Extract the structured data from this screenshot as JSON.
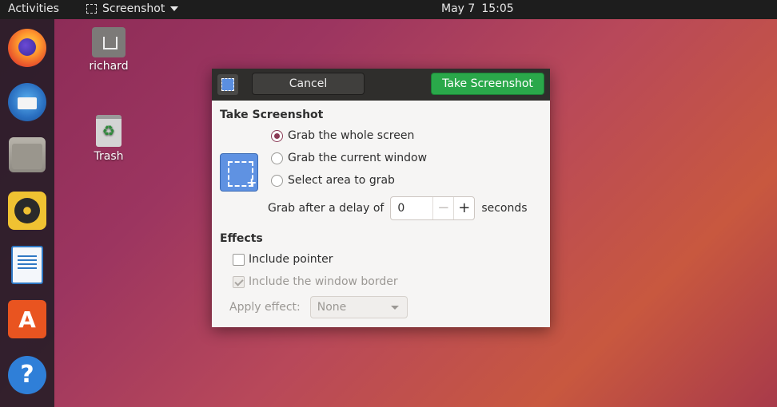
{
  "topbar": {
    "activities": "Activities",
    "app_name": "Screenshot",
    "date": "May 7",
    "time": "15:05"
  },
  "dock": {
    "apps": [
      "firefox-icon",
      "thunderbird-icon",
      "files-icon",
      "rhythmbox-icon",
      "libreoffice-writer-icon",
      "ubuntu-software-icon",
      "help-icon"
    ],
    "help_glyph": "?"
  },
  "desktop": {
    "home_label": "richard",
    "trash_label": "Trash",
    "trash_glyph": "♻"
  },
  "dialog": {
    "cancel_label": "Cancel",
    "take_label": "Take Screenshot",
    "section_title": "Take Screenshot",
    "options": [
      "Grab the whole screen",
      "Grab the current window",
      "Select area to grab"
    ],
    "selected_option": "Grab the whole screen",
    "delay_label": "Grab after a delay of",
    "delay_value": "0",
    "delay_unit": "seconds",
    "minus_glyph": "−",
    "plus_glyph": "+",
    "effects_title": "Effects",
    "include_pointer": "Include pointer",
    "include_pointer_checked": false,
    "include_border": "Include the window border",
    "include_border_checked": true,
    "apply_effect_label": "Apply effect:",
    "apply_effect_value": "None"
  },
  "colors": {
    "accent_green": "#2aa84a",
    "radio_selected": "#8a3a55",
    "topbar": "#1d1d1d"
  }
}
